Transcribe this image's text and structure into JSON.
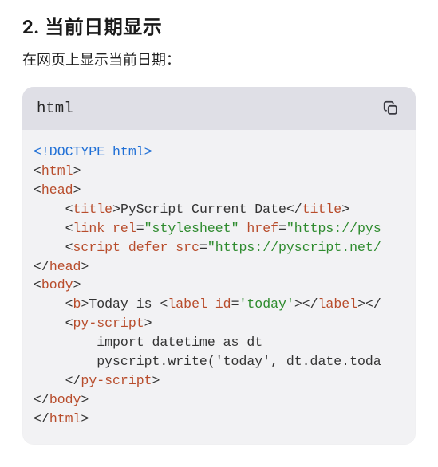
{
  "heading": "2. 当前日期显示",
  "subtext": "在网页上显示当前日期：",
  "code": {
    "language": "html",
    "tokens": [
      {
        "cls": "t-doctype",
        "txt": "<!DOCTYPE html>"
      },
      {
        "cls": "nl",
        "txt": "\n"
      },
      {
        "cls": "t-punct",
        "txt": "<"
      },
      {
        "cls": "t-tag",
        "txt": "html"
      },
      {
        "cls": "t-punct",
        "txt": ">"
      },
      {
        "cls": "nl",
        "txt": "\n"
      },
      {
        "cls": "t-punct",
        "txt": "<"
      },
      {
        "cls": "t-tag",
        "txt": "head"
      },
      {
        "cls": "t-punct",
        "txt": ">"
      },
      {
        "cls": "nl",
        "txt": "\n"
      },
      {
        "cls": "t-text",
        "txt": "    "
      },
      {
        "cls": "t-punct",
        "txt": "<"
      },
      {
        "cls": "t-tag",
        "txt": "title"
      },
      {
        "cls": "t-punct",
        "txt": ">"
      },
      {
        "cls": "t-text",
        "txt": "PyScript Current Date"
      },
      {
        "cls": "t-punct",
        "txt": "</"
      },
      {
        "cls": "t-tag",
        "txt": "title"
      },
      {
        "cls": "t-punct",
        "txt": ">"
      },
      {
        "cls": "nl",
        "txt": "\n"
      },
      {
        "cls": "t-text",
        "txt": "    "
      },
      {
        "cls": "t-punct",
        "txt": "<"
      },
      {
        "cls": "t-tag",
        "txt": "link"
      },
      {
        "cls": "t-text",
        "txt": " "
      },
      {
        "cls": "t-attr",
        "txt": "rel"
      },
      {
        "cls": "t-eq",
        "txt": "="
      },
      {
        "cls": "t-str",
        "txt": "\"stylesheet\""
      },
      {
        "cls": "t-text",
        "txt": " "
      },
      {
        "cls": "t-attr",
        "txt": "href"
      },
      {
        "cls": "t-eq",
        "txt": "="
      },
      {
        "cls": "t-str",
        "txt": "\"https://pys"
      },
      {
        "cls": "nl",
        "txt": "\n"
      },
      {
        "cls": "t-text",
        "txt": "    "
      },
      {
        "cls": "t-punct",
        "txt": "<"
      },
      {
        "cls": "t-tag",
        "txt": "script"
      },
      {
        "cls": "t-text",
        "txt": " "
      },
      {
        "cls": "t-attr",
        "txt": "defer"
      },
      {
        "cls": "t-text",
        "txt": " "
      },
      {
        "cls": "t-attr",
        "txt": "src"
      },
      {
        "cls": "t-eq",
        "txt": "="
      },
      {
        "cls": "t-str",
        "txt": "\"https://pyscript.net/"
      },
      {
        "cls": "nl",
        "txt": "\n"
      },
      {
        "cls": "t-punct",
        "txt": "</"
      },
      {
        "cls": "t-tag",
        "txt": "head"
      },
      {
        "cls": "t-punct",
        "txt": ">"
      },
      {
        "cls": "nl",
        "txt": "\n"
      },
      {
        "cls": "t-punct",
        "txt": "<"
      },
      {
        "cls": "t-tag",
        "txt": "body"
      },
      {
        "cls": "t-punct",
        "txt": ">"
      },
      {
        "cls": "nl",
        "txt": "\n"
      },
      {
        "cls": "t-text",
        "txt": "    "
      },
      {
        "cls": "t-punct",
        "txt": "<"
      },
      {
        "cls": "t-tag",
        "txt": "b"
      },
      {
        "cls": "t-punct",
        "txt": ">"
      },
      {
        "cls": "t-text",
        "txt": "Today is "
      },
      {
        "cls": "t-punct",
        "txt": "<"
      },
      {
        "cls": "t-tag",
        "txt": "label"
      },
      {
        "cls": "t-text",
        "txt": " "
      },
      {
        "cls": "t-attr",
        "txt": "id"
      },
      {
        "cls": "t-eq",
        "txt": "="
      },
      {
        "cls": "t-str",
        "txt": "'today'"
      },
      {
        "cls": "t-punct",
        "txt": ">"
      },
      {
        "cls": "t-punct",
        "txt": "</"
      },
      {
        "cls": "t-tag",
        "txt": "label"
      },
      {
        "cls": "t-punct",
        "txt": ">"
      },
      {
        "cls": "t-punct",
        "txt": "</"
      },
      {
        "cls": "nl",
        "txt": "\n"
      },
      {
        "cls": "t-text",
        "txt": "    "
      },
      {
        "cls": "t-punct",
        "txt": "<"
      },
      {
        "cls": "t-tag",
        "txt": "py-script"
      },
      {
        "cls": "t-punct",
        "txt": ">"
      },
      {
        "cls": "nl",
        "txt": "\n"
      },
      {
        "cls": "t-text",
        "txt": "        import datetime as dt"
      },
      {
        "cls": "nl",
        "txt": "\n"
      },
      {
        "cls": "t-text",
        "txt": "        pyscript.write('today', dt.date.toda"
      },
      {
        "cls": "nl",
        "txt": "\n"
      },
      {
        "cls": "t-text",
        "txt": "    "
      },
      {
        "cls": "t-punct",
        "txt": "</"
      },
      {
        "cls": "t-tag",
        "txt": "py-script"
      },
      {
        "cls": "t-punct",
        "txt": ">"
      },
      {
        "cls": "nl",
        "txt": "\n"
      },
      {
        "cls": "t-punct",
        "txt": "</"
      },
      {
        "cls": "t-tag",
        "txt": "body"
      },
      {
        "cls": "t-punct",
        "txt": ">"
      },
      {
        "cls": "nl",
        "txt": "\n"
      },
      {
        "cls": "t-punct",
        "txt": "</"
      },
      {
        "cls": "t-tag",
        "txt": "html"
      },
      {
        "cls": "t-punct",
        "txt": ">"
      }
    ]
  }
}
